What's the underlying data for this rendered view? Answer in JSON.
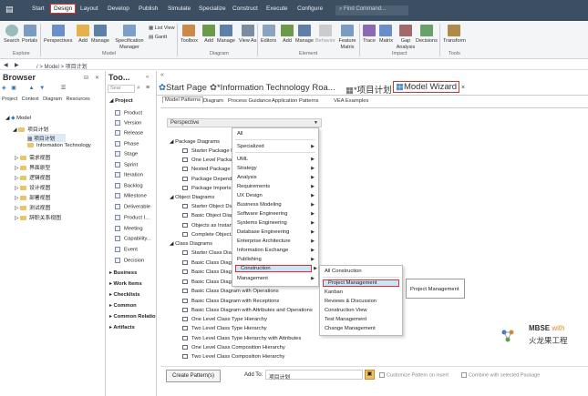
{
  "menubar": {
    "items": [
      "Start",
      "Design",
      "Layout",
      "Develop",
      "Publish",
      "Simulate",
      "Specialize",
      "Construct",
      "Execute",
      "Configure"
    ],
    "active": "Design",
    "search_placeholder": "Find Command..."
  },
  "ribbon": {
    "buttons": [
      "Search",
      "Portals",
      "Perspectives",
      "Add",
      "Manage",
      "Specification Manager",
      "List View",
      "Gantt",
      "Toolbox",
      "Add",
      "Manage",
      "View As",
      "Editors",
      "Add",
      "Manage",
      "Behavior",
      "Feature Matrix",
      "Trace",
      "Matrix",
      "Gap Analysis",
      "Decisions",
      "Transform"
    ],
    "groups": [
      "Explore",
      "Model",
      "Diagram",
      "Element",
      "Impact",
      "Tools"
    ]
  },
  "address": {
    "path": "/ > Model > 项目计划"
  },
  "browser": {
    "title": "Browser",
    "tabs": [
      "Project",
      "Context",
      "Diagram",
      "Resources"
    ],
    "tree": [
      {
        "label": "Model",
        "level": 0
      },
      {
        "label": "项目计划",
        "level": 1
      },
      {
        "label": "项目计划",
        "level": 2
      },
      {
        "label": "Information Technology",
        "level": 2
      },
      {
        "label": "需求视图",
        "level": 1
      },
      {
        "label": "界面原型",
        "level": 1
      },
      {
        "label": "逻辑视图",
        "level": 1
      },
      {
        "label": "设计视图",
        "level": 1
      },
      {
        "label": "部署视图",
        "level": 1
      },
      {
        "label": "测试视图",
        "level": 1
      },
      {
        "label": "辞职关系视图",
        "level": 1
      }
    ]
  },
  "toolbox": {
    "title": "Too...",
    "search_placeholder": "Sear",
    "section": "Project",
    "items": [
      "Product",
      "Version",
      "Release",
      "Phase",
      "Stage",
      "Sprint",
      "Iteration",
      "Backlog",
      "Milestone",
      "Deliverable",
      "Product I...",
      "Meeting",
      "Capability...",
      "Event",
      "Decision"
    ],
    "collapsed": [
      "Business",
      "Work Items",
      "Checklists",
      "Common",
      "Common Relatio",
      "Artifacts"
    ]
  },
  "doc_tabs": {
    "items": [
      "Start Page",
      "*Information Technology Roa...",
      "*项目计划",
      "Model Wizard"
    ],
    "active": "Model Wizard",
    "close": "×"
  },
  "sub_tabs": {
    "items": [
      "Model Patterns",
      "Diagram",
      "Process Guidance",
      "Application Patterns",
      "VEA Examples"
    ],
    "active": "Model Patterns"
  },
  "perspective": {
    "label": "Perspective"
  },
  "patterns": {
    "sections": [
      {
        "title": "Package Diagrams",
        "items": [
          "Starter Package Di...",
          "One Level Package...",
          "Nested Package H...",
          "Package Depende...",
          "Package Imports"
        ]
      },
      {
        "title": "Object Diagrams",
        "items": [
          "Starter Object Dia...",
          "Basic Object Diag...",
          "Objects as Instanc...",
          "Complete Object..."
        ]
      },
      {
        "title": "Class Diagrams",
        "items": [
          "Starter Class Diagr...",
          "Basic Class Diagra...",
          "Basic Class Diagra...",
          "Basic Class Diagra...",
          "Basic Class Diagram with Operations",
          "Basic Class Diagram with Receptions",
          "Basic Class Diagram with Attributes and Operations",
          "One Level Class Type Hierarchy",
          "Two Level Class Type Hierarchy",
          "Two Level Class Type Hierarchy with Attributes",
          "One Level Class Composition Hierarchy",
          "Two Level Class Composition Hierarchy"
        ]
      }
    ]
  },
  "menu1": {
    "items": [
      "All",
      "Specialized",
      "UML",
      "Strategy",
      "Analysis",
      "Requirements",
      "UX Design",
      "Business Modeling",
      "Software Engineering",
      "Systems Engineering",
      "Database Engineering",
      "Enterprise Architecture",
      "Information Exchange",
      "Publishing",
      "Construction",
      "Management"
    ],
    "highlighted": "Construction"
  },
  "menu2": {
    "items": [
      "All Construction",
      "Project Management",
      "Kanban",
      "Reviews & Discussion",
      "Construction View",
      "Test Management",
      "Change Management"
    ],
    "highlighted": "Project Management"
  },
  "tooltip": {
    "text": "Project Management"
  },
  "bottom": {
    "create_button": "Create Pattern(s)",
    "add_to_label": "Add To:",
    "add_to_value": "项目计划",
    "customize": "Customize Pattern on insert",
    "combine": "Combine with selected Package"
  },
  "watermark": {
    "line1": "MBSE",
    "line1b": "with",
    "line2": "火龙果工程"
  },
  "colors": {
    "menubar": "#3c4f62",
    "highlight": "#e03030",
    "accent": "#cfe3f7"
  }
}
